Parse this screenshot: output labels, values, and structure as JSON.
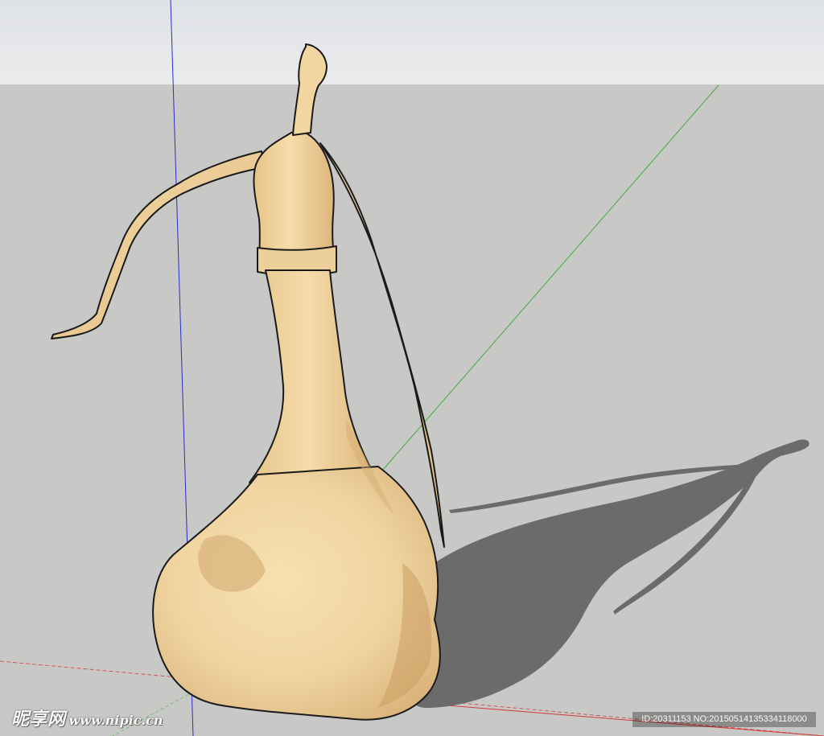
{
  "scene": {
    "sky_color": "#e4e6e9",
    "ground_color": "#c8c8c6",
    "shadow_color": "#6b6b6b",
    "model_color": "#f0d4a0",
    "model_shade_color": "#cfa568",
    "outline_color": "#1a1a1a",
    "axis_colors": {
      "x_red": "#d23a3a",
      "y_green": "#3fae3f",
      "z_blue": "#2c2ccc"
    },
    "model_icon": "figure-gourd-sculpture",
    "shadow_icon": "cast-shadow"
  },
  "watermark": {
    "brand": "昵享网",
    "site": "www.nipic.cn",
    "id_text": "ID:20311153 NO:20150514135334118000"
  }
}
